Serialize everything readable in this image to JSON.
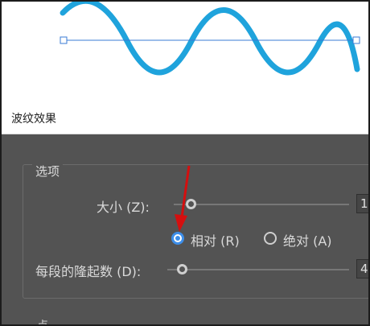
{
  "dialog": {
    "title": "波纹效果",
    "group_label": "选项",
    "size": {
      "label": "大小 (Z):",
      "value": "1"
    },
    "mode": {
      "relative_label": "相对 (R)",
      "absolute_label": "绝对 (A)",
      "selected": "relative"
    },
    "ridges": {
      "label": "每段的隆起数 (D):",
      "value": "4"
    },
    "points_label_partial": "点"
  },
  "colors": {
    "wave": "#1fa3dc",
    "dialog_bg": "#535353",
    "radio_selected": "#3d8ee9",
    "annotation_arrow": "#d40f0f"
  },
  "icons": {
    "annotation": "red-arrow-icon"
  }
}
